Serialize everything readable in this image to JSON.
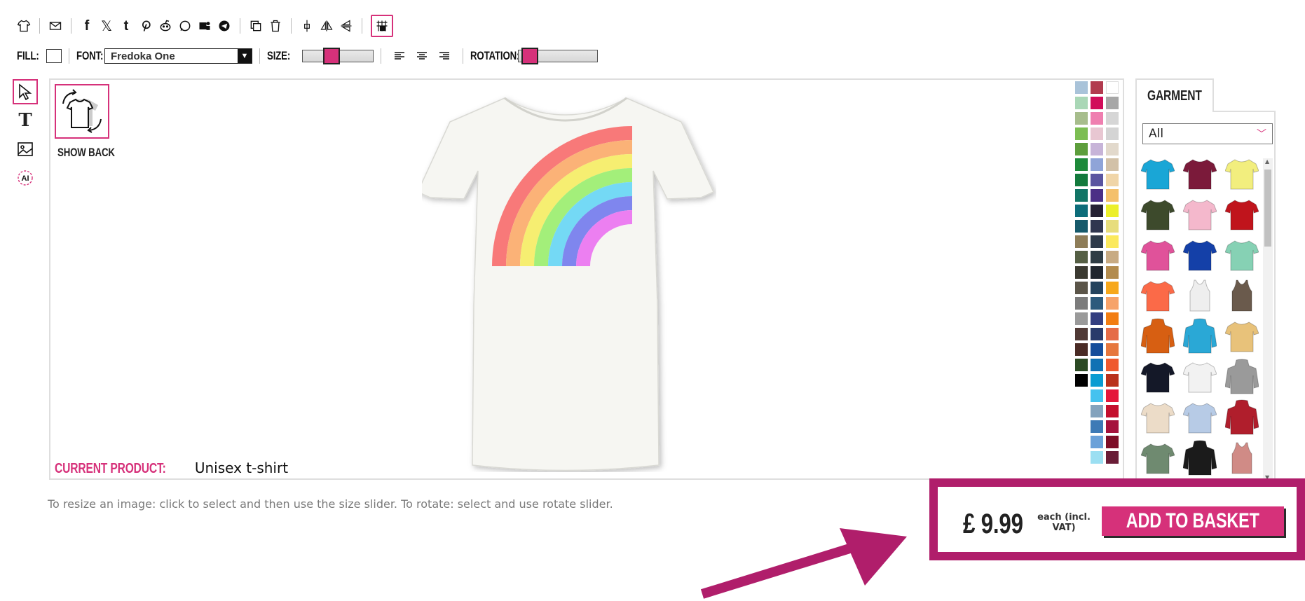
{
  "toolbar": {
    "icons": [
      "tshirt-icon",
      "email-icon",
      "facebook-icon",
      "x-twitter-icon",
      "tumblr-icon",
      "pinterest-icon",
      "reddit-icon",
      "whatsapp-icon",
      "teams-icon",
      "telegram-icon",
      "duplicate-icon",
      "delete-icon",
      "center-icon",
      "flip-horizontal-icon",
      "flip-vertical-icon",
      "grid-snap-icon"
    ]
  },
  "props": {
    "fill_label": "FILL:",
    "font_label": "FONT:",
    "font_value": "Fredoka One",
    "size_label": "SIZE:",
    "size_level": 0.38,
    "rotation_label": "ROTATION:",
    "rotation_level": 0.05
  },
  "canvas": {
    "show_back_label": "SHOW BACK",
    "current_product_label": "CURRENT PRODUCT:",
    "current_product_value": "Unisex t-shirt",
    "shirt_color": "#f6f6f2"
  },
  "swatches": {
    "col1": [
      "#a9c3d9",
      "#a9d7b6",
      "#a7bd8c",
      "#7cbe53",
      "#5d9e3c",
      "#1e8a3a",
      "#137a3d",
      "#127566",
      "#0d6d7a",
      "#175a6b",
      "#8e7d58",
      "#555f44",
      "#3b3a31",
      "#5b5549",
      "#7c7c7c",
      "#9a9a9a",
      "#503a36",
      "#4a2b25",
      "#2c4a24",
      "#000000"
    ],
    "col2": [
      "#b23b4f",
      "#d10d5a",
      "#ef7fb0",
      "#e8c7d2",
      "#c7b4d8",
      "#8fa4d8",
      "#5b55a0",
      "#4b2f86",
      "#262234",
      "#30364f",
      "#2e3a4a",
      "#2e3c44",
      "#20262e",
      "#24435d",
      "#2c5a7c",
      "#333e80",
      "#293a6b",
      "#154d9b",
      "#1071b4",
      "#0a9cd2",
      "#45c2ef",
      "#84a3bd",
      "#3d7ab6",
      "#6aa1d9",
      "#9bdff2"
    ],
    "col3": [
      "#ffffff",
      "#a7a7a7",
      "#d6d6d6",
      "#d4d4d4",
      "#e2d9cc",
      "#d2c1a8",
      "#f0d5a8",
      "#f4c06b",
      "#ecef2b",
      "#e7dd7c",
      "#fbe95d",
      "#c8ab83",
      "#b38c4e",
      "#f7a81b",
      "#f6a36a",
      "#f27d12",
      "#e56c48",
      "#e6773e",
      "#ef5a2f",
      "#b9311b",
      "#e4173b",
      "#c40f2d",
      "#a5123d",
      "#7d0d27",
      "#6a1d37"
    ]
  },
  "garment": {
    "tab_label": "GARMENT",
    "filter_value": "All",
    "items": [
      {
        "name": "turquoise-tshirt",
        "color": "#1aa6d6",
        "type": "tee"
      },
      {
        "name": "maroon-tshirt",
        "color": "#7b1a3a",
        "type": "tee"
      },
      {
        "name": "yellow-tshirt",
        "color": "#f2ee7e",
        "type": "tee"
      },
      {
        "name": "olive-tshirt",
        "color": "#3d4a2c",
        "type": "tee"
      },
      {
        "name": "pink-tshirt",
        "color": "#f4b8cc",
        "type": "tee"
      },
      {
        "name": "red-tshirt",
        "color": "#c0141c",
        "type": "tee"
      },
      {
        "name": "fuchsia-tshirt",
        "color": "#e0529a",
        "type": "tee"
      },
      {
        "name": "royal-tshirt",
        "color": "#1440a8",
        "type": "tee"
      },
      {
        "name": "mint-tshirt",
        "color": "#86d1b4",
        "type": "tee"
      },
      {
        "name": "coral-tshirt",
        "color": "#fb6a48",
        "type": "tee"
      },
      {
        "name": "white-vest",
        "color": "#eeeeee",
        "type": "vest"
      },
      {
        "name": "brown-vest",
        "color": "#6a5a4c",
        "type": "vest"
      },
      {
        "name": "orange-hoodie",
        "color": "#d75f12",
        "type": "hoodie"
      },
      {
        "name": "aqua-hoodie",
        "color": "#2aa8d6",
        "type": "hoodie"
      },
      {
        "name": "tiedye-tshirt",
        "color": "#e8c27a",
        "type": "tee"
      },
      {
        "name": "navy-tshirt",
        "color": "#141828",
        "type": "tee"
      },
      {
        "name": "baseball-tshirt",
        "color": "#f2f2f2",
        "type": "tee"
      },
      {
        "name": "grey-hoodie",
        "color": "#9a9a9a",
        "type": "hoodie"
      },
      {
        "name": "cream-tshirt",
        "color": "#ecdcc8",
        "type": "tee"
      },
      {
        "name": "dipdye-tshirt",
        "color": "#b7cbe6",
        "type": "tee"
      },
      {
        "name": "varsity-jacket",
        "color": "#b01e2c",
        "type": "hoodie"
      },
      {
        "name": "sage-longsleeve",
        "color": "#6f8a70",
        "type": "tee"
      },
      {
        "name": "black-orange-hoodie",
        "color": "#1b1b1b",
        "type": "hoodie"
      },
      {
        "name": "rose-vest",
        "color": "#d08b86",
        "type": "vest"
      }
    ]
  },
  "help_text": "To resize an image: click to select and then use the size slider. To rotate: select and use rotate slider.",
  "basket": {
    "price": "£ 9.99",
    "price_note": "each (incl. VAT)",
    "button_label": "ADD TO BASKET",
    "accent": "#b01e6b",
    "button_color": "#d6317a"
  }
}
